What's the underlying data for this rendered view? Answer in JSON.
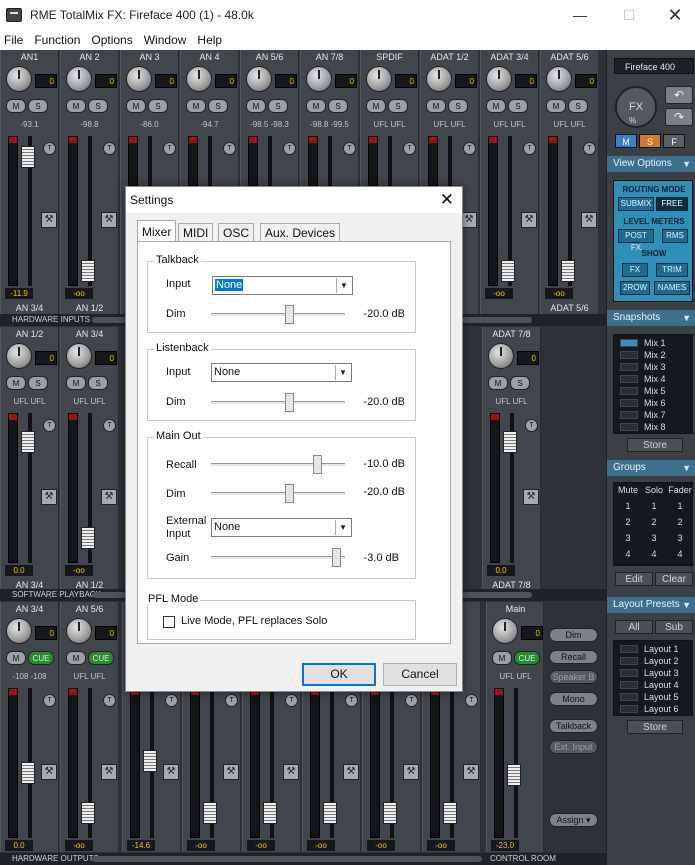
{
  "window": {
    "title": "RME TotalMix FX: Fireface 400 (1) - 48.0k",
    "min": "—",
    "max": "☐",
    "close": "✕"
  },
  "menu": [
    "File",
    "Function",
    "Options",
    "Window",
    "Help"
  ],
  "inputs": {
    "label": "HARDWARE INPUTS",
    "channels": [
      {
        "name": "AN1",
        "knob": "0",
        "m": "M",
        "s": "S",
        "peak": "-93.1",
        "value": "-11.9",
        "route": "AN 3/4"
      },
      {
        "name": "AN 2",
        "knob": "0",
        "m": "M",
        "s": "S",
        "peak": "-98.8",
        "value": "-oo",
        "route": "AN 1/2"
      },
      {
        "name": "AN 3",
        "knob": "0",
        "m": "M",
        "s": "S",
        "peak": "-86.0",
        "value": "",
        "route": ""
      },
      {
        "name": "AN 4",
        "knob": "0",
        "m": "M",
        "s": "S",
        "peak": "-94.7",
        "value": "",
        "route": ""
      },
      {
        "name": "AN 5/6",
        "knob": "0",
        "m": "M",
        "s": "S",
        "peak": "-98.5 -98.3",
        "value": "",
        "route": ""
      },
      {
        "name": "AN 7/8",
        "knob": "0",
        "m": "M",
        "s": "S",
        "peak": "-98.8 -99.5",
        "value": "",
        "route": ""
      },
      {
        "name": "SPDIF",
        "knob": "0",
        "m": "M",
        "s": "S",
        "peak": "UFL UFL",
        "value": "",
        "route": ""
      },
      {
        "name": "ADAT 1/2",
        "knob": "0",
        "m": "M",
        "s": "S",
        "peak": "UFL UFL",
        "value": "-oo",
        "route": ""
      },
      {
        "name": "ADAT 3/4",
        "knob": "0",
        "m": "M",
        "s": "S",
        "peak": "UFL UFL",
        "value": "-oo",
        "route": ""
      },
      {
        "name": "ADAT 5/6",
        "knob": "0",
        "m": "M",
        "s": "S",
        "peak": "UFL UFL",
        "value": "-oo",
        "route": "ADAT 5/6"
      }
    ]
  },
  "playback": {
    "label": "SOFTWARE PLAYBACK",
    "channels": [
      {
        "name": "AN 1/2",
        "knob": "0",
        "m": "M",
        "s": "S",
        "peak": "UFL UFL",
        "value": "0.0",
        "route": "AN 3/4"
      },
      {
        "name": "AN 3/4",
        "knob": "0",
        "m": "M",
        "s": "S",
        "peak": "UFL UFL",
        "value": "-oo",
        "route": "AN 1/2"
      },
      {
        "name": "ADAT 7/8",
        "knob": "0",
        "m": "M",
        "s": "S",
        "peak": "UFL UFL",
        "value": "0.0",
        "route": "ADAT 7/8"
      }
    ]
  },
  "outputs": {
    "label": "HARDWARE OUTPUTS",
    "channels": [
      {
        "name": "AN 3/4",
        "knob": "0",
        "m": "M",
        "cue": "CUE",
        "peak": "-108 -108",
        "value": "0.0"
      },
      {
        "name": "AN 5/6",
        "knob": "0",
        "m": "M",
        "cue": "CUE",
        "peak": "UFL UFL",
        "value": "-oo"
      },
      {
        "name": "",
        "knob": "",
        "value": "-14.6"
      },
      {
        "name": "",
        "knob": "",
        "value": "-oo"
      },
      {
        "name": "",
        "knob": "",
        "value": "-oo"
      },
      {
        "name": "",
        "knob": "",
        "value": "-oo"
      },
      {
        "name": "",
        "knob": "",
        "value": "-oo"
      },
      {
        "name": "",
        "knob": "",
        "value": "-oo"
      }
    ],
    "main": {
      "name": "Main",
      "knob": "0",
      "m": "M",
      "cue": "CUE",
      "peak": "UFL UFL",
      "value": "-23.0"
    }
  },
  "control_room": {
    "label": "CONTROL ROOM",
    "buttons": [
      "Dim",
      "Recall",
      "Speaker B",
      "Mono",
      "Talkback",
      "Ext. Input",
      "Assign ▾"
    ]
  },
  "right_panel": {
    "device": "Fireface 400",
    "fx": "FX",
    "fx_pct": "%",
    "msf": [
      "M",
      "S",
      "F"
    ],
    "view_options": {
      "title": "View Options",
      "routing_mode": "ROUTING MODE",
      "submix": "SUBMIX",
      "free": "FREE",
      "level_meters": "LEVEL METERS",
      "postfx": "POST FX",
      "rms": "RMS",
      "show": "SHOW",
      "fx_btn": "FX",
      "trim": "TRIM",
      "row2": "2ROW",
      "names": "NAMES"
    },
    "snapshots": {
      "title": "Snapshots",
      "items": [
        "Mix 1",
        "Mix 2",
        "Mix 3",
        "Mix 4",
        "Mix 5",
        "Mix 6",
        "Mix 7",
        "Mix 8"
      ],
      "store": "Store"
    },
    "groups": {
      "title": "Groups",
      "cols": [
        "Mute",
        "Solo",
        "Fader"
      ],
      "rows": [
        "1",
        "2",
        "3",
        "4"
      ],
      "edit": "Edit",
      "clear": "Clear"
    },
    "layout_presets": {
      "title": "Layout Presets",
      "all": "All",
      "sub": "Sub",
      "items": [
        "Layout 1",
        "Layout 2",
        "Layout 3",
        "Layout 4",
        "Layout 5",
        "Layout 6"
      ],
      "store": "Store"
    }
  },
  "dialog": {
    "title": "Settings",
    "close": "✕",
    "tabs": [
      "Mixer",
      "MIDI",
      "OSC",
      "Aux. Devices"
    ],
    "talkback": {
      "title": "Talkback",
      "input_label": "Input",
      "input_value": "None",
      "dim_label": "Dim",
      "dim_value": "-20.0 dB",
      "dim_level": 0.58
    },
    "listenback": {
      "title": "Listenback",
      "input_label": "Input",
      "input_value": "None",
      "dim_label": "Dim",
      "dim_value": "-20.0 dB",
      "dim_level": 0.58
    },
    "main_out": {
      "title": "Main Out",
      "recall_label": "Recall",
      "recall_value": "-10.0 dB",
      "recall_level": 0.79,
      "dim_label": "Dim",
      "dim_value": "-20.0 dB",
      "dim_level": 0.58,
      "ext_label_1": "External",
      "ext_label_2": "Input",
      "ext_value": "None",
      "gain_label": "Gain",
      "gain_value": "-3.0 dB",
      "gain_level": 0.93
    },
    "pfl": {
      "title": "PFL Mode",
      "checkbox_label": "Live Mode,  PFL replaces Solo"
    },
    "ok": "OK",
    "cancel": "Cancel"
  }
}
